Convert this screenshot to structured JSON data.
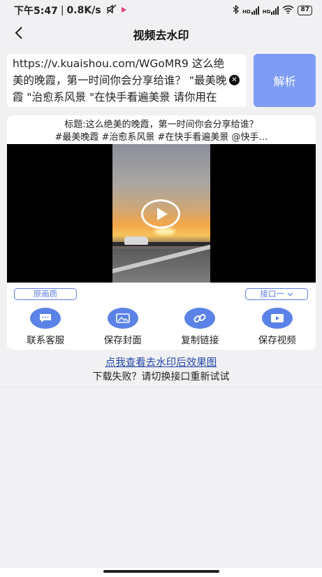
{
  "status_bar": {
    "time": "下午5:47",
    "separator": "|",
    "speed": "0.8K/s",
    "net1": "HD",
    "net2": "HD",
    "battery": "87"
  },
  "header": {
    "title": "视频去水印",
    "back_icon": "chevron-left-icon"
  },
  "input": {
    "value": "https://v.kuaishou.com/WGoMR9 这么绝美的晚霞，第一时间你会分享给谁？ \"最美晚霞 \"治愈系风景 \"在快手看遍美景 请你用在快手碎播",
    "clear_icon": "close-icon"
  },
  "parse_button": "解析",
  "video": {
    "title_line1": "标题:这么绝美的晚霞，第一时间你会分享给谁？",
    "title_line2": "#最美晚霞 #治愈系风景 #在快手看遍美景 @快手…",
    "play_icon": "play-icon"
  },
  "quality_button": "原画质",
  "port_select": "接口一",
  "actions": [
    {
      "label": "联系客服",
      "icon": "chat-icon"
    },
    {
      "label": "保存封面",
      "icon": "image-icon"
    },
    {
      "label": "复制链接",
      "icon": "link-icon"
    },
    {
      "label": "保存视频",
      "icon": "video-icon"
    }
  ],
  "effect_link": "点我查看去水印后效果图",
  "fail_tip": "下载失败？请切换接口重新试试",
  "colors": {
    "accent": "#5b82e6",
    "parse_button": "#7e9cf3",
    "link": "#2446a8"
  }
}
